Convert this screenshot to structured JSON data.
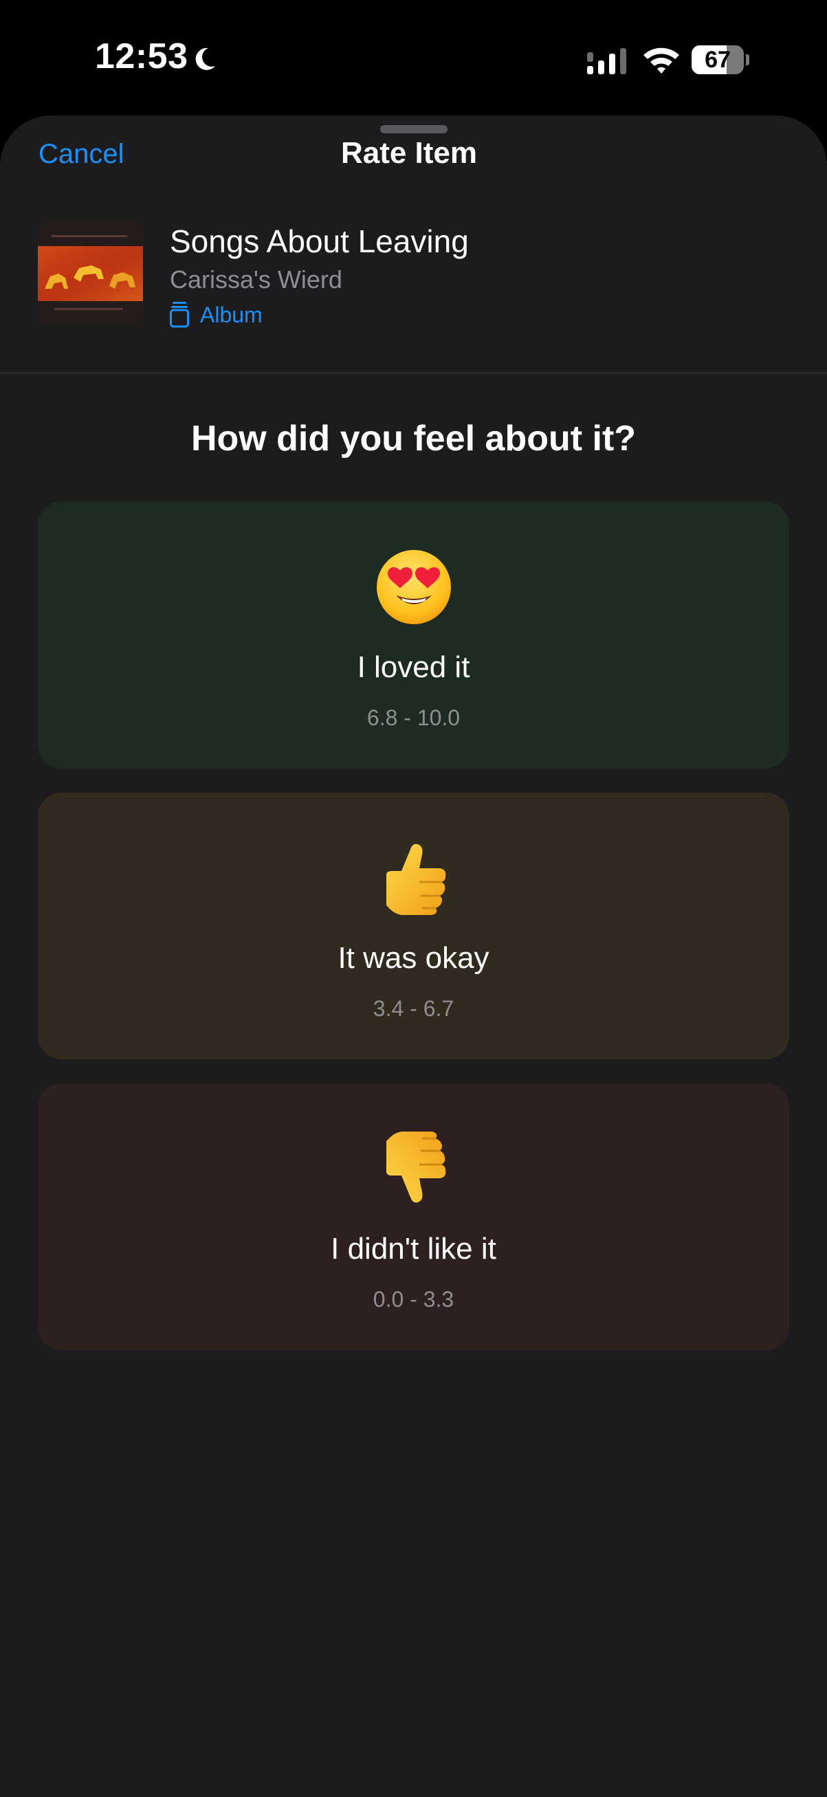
{
  "status_bar": {
    "time": "12:53",
    "battery_level": "67",
    "icons": [
      "moon-icon",
      "cellular-signal-icon",
      "wifi-icon",
      "battery-icon"
    ]
  },
  "nav": {
    "cancel_label": "Cancel",
    "title": "Rate Item"
  },
  "item": {
    "title": "Songs About Leaving",
    "artist": "Carissa's Wierd",
    "type_label": "Album",
    "type_icon": "album-icon"
  },
  "question": "How did you feel about it?",
  "options": [
    {
      "emoji_icon": "heart-eyes-face-icon",
      "label": "I loved it",
      "range": "6.8 - 10.0",
      "background": "#1e2b23"
    },
    {
      "emoji_icon": "thumbs-up-icon",
      "label": "It was okay",
      "range": "3.4 - 6.7",
      "background": "#302a1f"
    },
    {
      "emoji_icon": "thumbs-down-icon",
      "label": "I didn't like it",
      "range": "0.0 - 3.3",
      "background": "#2e1f21"
    }
  ],
  "colors": {
    "accent": "#1e8ff5",
    "sheet_background": "#1c1c1e",
    "secondary_text": "#8e8e93"
  }
}
